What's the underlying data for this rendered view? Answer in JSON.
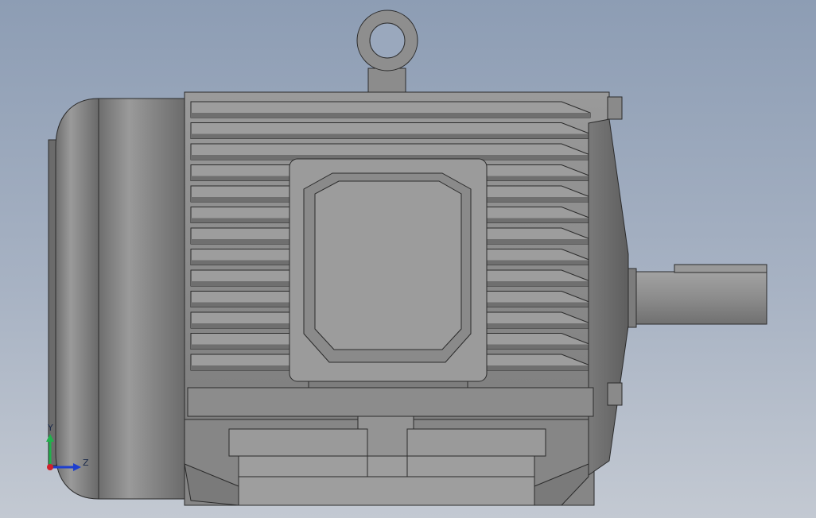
{
  "viewport": {
    "background_top": "#8d9db4",
    "background_bottom": "#c3c9d2"
  },
  "model": {
    "body_color": "#8a8a8a",
    "edge_color": "#2b2b2b"
  },
  "triad": {
    "y_label": "Y",
    "z_label": "Z",
    "y_color": "#22b14c",
    "z_color": "#1e3fcf",
    "x_color": "#d0202a"
  }
}
